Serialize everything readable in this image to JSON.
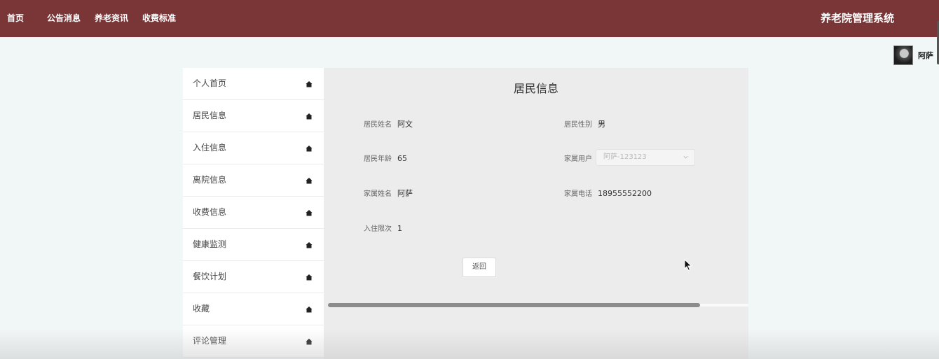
{
  "header": {
    "nav": [
      "首页",
      "公告消息",
      "养老资讯",
      "收费标准"
    ],
    "brand": "养老院管理系统"
  },
  "user": {
    "name": "阿萨",
    "avatar_icon": "user-avatar"
  },
  "sidebar": {
    "items": [
      {
        "label": "个人首页",
        "icon": "home-icon"
      },
      {
        "label": "居民信息",
        "icon": "home-icon"
      },
      {
        "label": "入住信息",
        "icon": "home-icon"
      },
      {
        "label": "离院信息",
        "icon": "home-icon"
      },
      {
        "label": "收费信息",
        "icon": "home-icon"
      },
      {
        "label": "健康监测",
        "icon": "home-icon"
      },
      {
        "label": "餐饮计划",
        "icon": "home-icon"
      },
      {
        "label": "收藏",
        "icon": "home-icon"
      },
      {
        "label": "评论管理",
        "icon": "home-icon"
      }
    ]
  },
  "detail": {
    "title": "居民信息",
    "fields": {
      "resident_name": {
        "label": "居民姓名",
        "value": "阿文"
      },
      "resident_gender": {
        "label": "居民性别",
        "value": "男"
      },
      "resident_age": {
        "label": "居民年龄",
        "value": "65"
      },
      "family_user": {
        "label": "家属用户",
        "value": "阿萨-123123"
      },
      "family_name": {
        "label": "家属姓名",
        "value": "阿萨"
      },
      "family_phone": {
        "label": "家属电话",
        "value": "18955552200"
      },
      "stay_count": {
        "label": "入住限次",
        "value": "1"
      }
    },
    "back_label": "返回"
  },
  "colors": {
    "header_bg": "#7a3537",
    "page_bg": "#f1f6f6",
    "panel_bg": "#ececec"
  }
}
